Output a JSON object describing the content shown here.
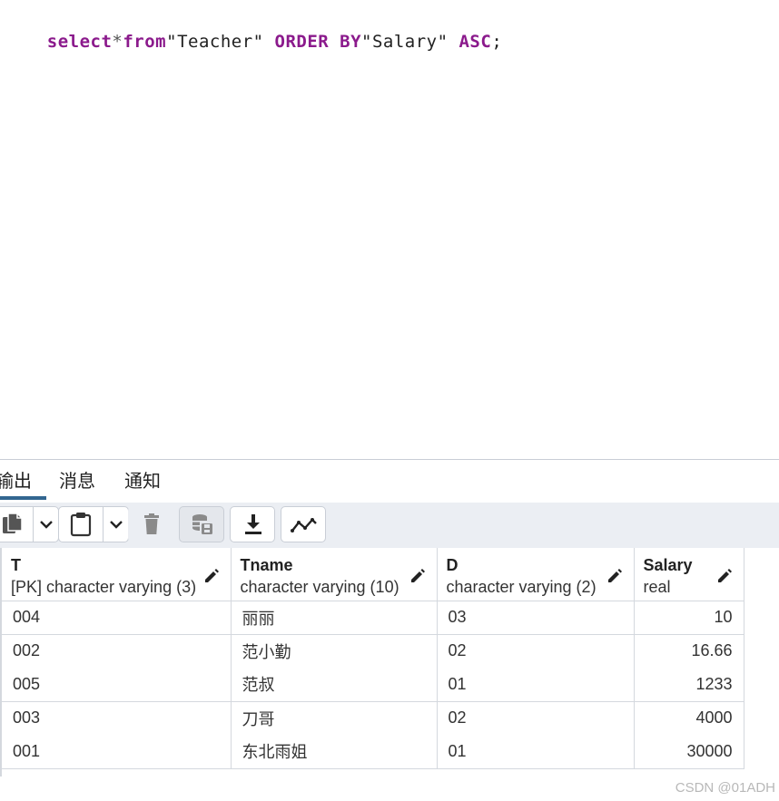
{
  "editor": {
    "tokens": [
      {
        "text": "select",
        "kind": "kw"
      },
      {
        "text": "*",
        "kind": "op"
      },
      {
        "text": "from",
        "kind": "kw"
      },
      {
        "text": "\"Teacher\" ",
        "kind": "str"
      },
      {
        "text": "ORDER BY",
        "kind": "kw"
      },
      {
        "text": "\"Salary\" ",
        "kind": "str"
      },
      {
        "text": "ASC",
        "kind": "kw"
      },
      {
        "text": ";",
        "kind": "str"
      }
    ]
  },
  "tabs": [
    {
      "label": "输出",
      "active": true
    },
    {
      "label": "消息",
      "active": false
    },
    {
      "label": "通知",
      "active": false
    }
  ],
  "toolbar": {
    "icons": [
      "copy-icon",
      "chevron-down-icon",
      "paste-icon",
      "chevron-down-icon",
      "delete-icon",
      "save-data-icon",
      "download-icon",
      "graph-icon"
    ]
  },
  "grid": {
    "columns": [
      {
        "name": "T",
        "type": "[PK] character varying (3)"
      },
      {
        "name": "Tname",
        "type": "character varying (10)"
      },
      {
        "name": "D",
        "type": "character varying (2)"
      },
      {
        "name": "Salary",
        "type": "real"
      }
    ],
    "rows": [
      [
        "004",
        "丽丽",
        "03",
        "10"
      ],
      [
        "002",
        "范小勤",
        "02",
        "16.66"
      ],
      [
        "005",
        "范叔",
        "01",
        "1233"
      ],
      [
        "003",
        "刀哥",
        "02",
        "4000"
      ],
      [
        "001",
        "东北雨姐",
        "01",
        "30000"
      ]
    ]
  },
  "colors": {
    "keyword": "#8b1a8c",
    "tab_underline": "#326690",
    "toolbar_bg": "#ebeef3"
  },
  "watermark": "CSDN @01ADH"
}
